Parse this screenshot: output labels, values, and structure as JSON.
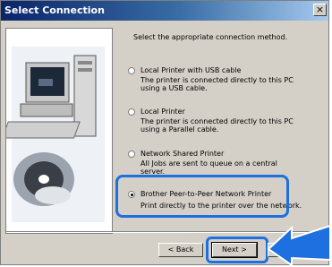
{
  "window": {
    "title": "Select Connection",
    "close_label": "×"
  },
  "instruction": "Select the appropriate connection method.",
  "options": [
    {
      "label": "Local Printer with USB cable",
      "description": "The printer is connected directly to this PC using a USB cable.",
      "selected": false
    },
    {
      "label": "Local Printer",
      "description": "The printer is connected directly to this PC using a Parallel cable.",
      "selected": false
    },
    {
      "label": "Network Shared Printer",
      "description": "All Jobs are sent to queue on a central server.",
      "selected": false
    },
    {
      "label": "Brother Peer-to-Peer Network Printer",
      "description": "Print directly to the printer over the network.",
      "selected": true
    }
  ],
  "buttons": {
    "back": "< Back",
    "next": "Next >"
  },
  "colors": {
    "callout": "#1e6fe0",
    "title_bar": "#0a246a"
  }
}
